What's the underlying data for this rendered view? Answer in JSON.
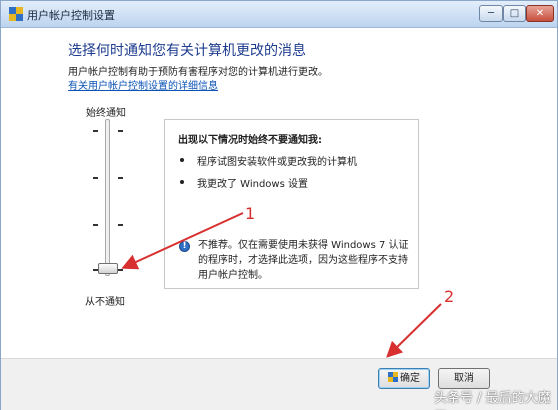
{
  "window": {
    "title": "用户帐户控制设置",
    "min_glyph": "─",
    "max_glyph": "□",
    "close_glyph": "✕"
  },
  "main": {
    "heading": "选择何时通知您有关计算机更改的消息",
    "description": "用户帐户控制有助于预防有害程序对您的计算机进行更改。",
    "link": "有关用户帐户控制设置的详细信息"
  },
  "slider": {
    "top_label": "始终通知",
    "bottom_label": "从不通知",
    "level_index": 0,
    "level_count": 4
  },
  "panel": {
    "title": "出现以下情况时始终不要通知我:",
    "items": [
      "程序试图安装软件或更改我的计算机",
      "我更改了 Windows 设置"
    ],
    "note": "不推荐。仅在需要使用未获得 Windows 7 认证的程序时，才选择此选项，因为这些程序不支持用户帐户控制。"
  },
  "footer": {
    "ok_label": "确定",
    "cancel_label": "取消"
  },
  "annotations": {
    "label_1": "1",
    "label_2": "2",
    "color": "#d83030"
  },
  "watermark": "头条号 / 最后的大魔王"
}
